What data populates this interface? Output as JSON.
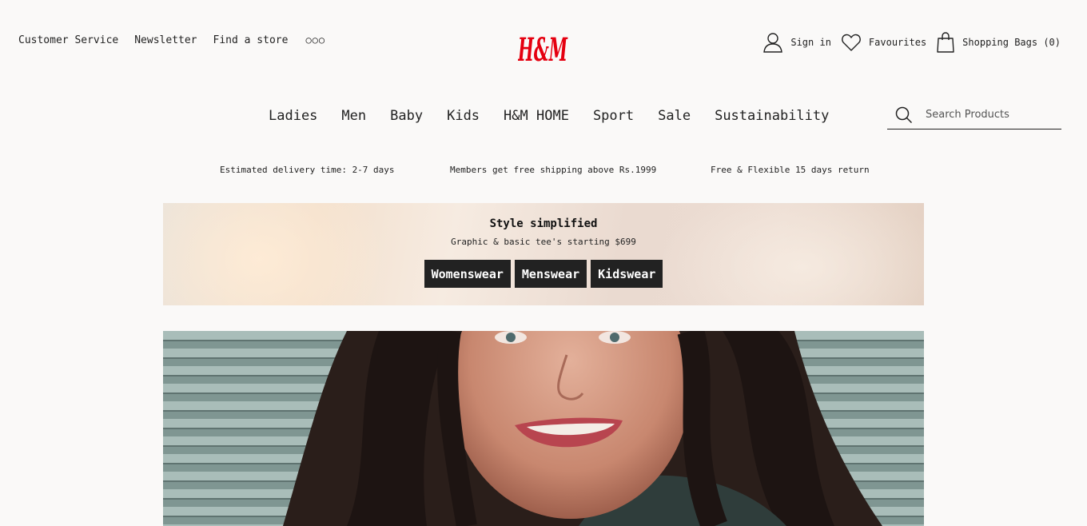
{
  "header": {
    "links": [
      "Customer Service",
      "Newsletter",
      "Find a store"
    ],
    "more": "○○○",
    "logo": "H&M",
    "sign_in": "Sign in",
    "favourites": "Favourites",
    "shopping_bags": "Shopping Bags (0)"
  },
  "nav": {
    "items": [
      "Ladies",
      "Men",
      "Baby",
      "Kids",
      "H&M HOME",
      "Sport",
      "Sale",
      "Sustainability"
    ]
  },
  "search": {
    "placeholder": "Search Products"
  },
  "info_bar": {
    "items": [
      "Estimated delivery time: 2-7 days",
      "Members get free shipping above Rs.1999",
      "Free & Flexible 15 days return"
    ]
  },
  "promo": {
    "title": "Style simplified",
    "subtitle": "Graphic & basic tee's starting $699",
    "buttons": [
      "Womenswear",
      "Menswear",
      "Kidswear"
    ]
  },
  "colors": {
    "brand": "#e50010",
    "button_bg": "#222222",
    "background": "#faf9f8"
  }
}
